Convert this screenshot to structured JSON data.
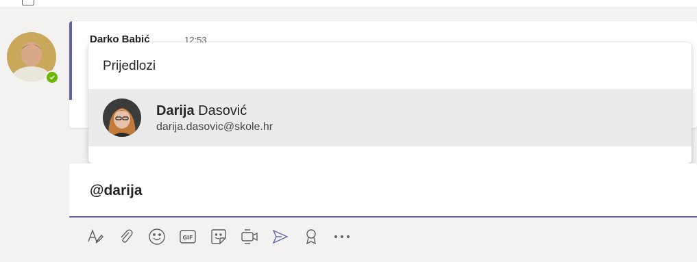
{
  "message": {
    "author": "Darko Babić",
    "time": "12:53"
  },
  "suggestions": {
    "title": "Prijedlozi",
    "items": [
      {
        "first_name": "Darija",
        "last_name": "Dasović",
        "email": "darija.dasovic@skole.hr",
        "avatar_icon": "person-avatar-icon"
      }
    ]
  },
  "compose": {
    "text": "@darija"
  },
  "toolbar": {
    "icons": [
      "format-icon",
      "attach-icon",
      "emoji-icon",
      "gif-icon",
      "sticker-icon",
      "meet-now-icon",
      "stream-icon",
      "praise-icon",
      "more-options-icon"
    ]
  },
  "colors": {
    "accent": "#6264a7",
    "presence": "#6bb700",
    "icon": "#605e5c"
  }
}
